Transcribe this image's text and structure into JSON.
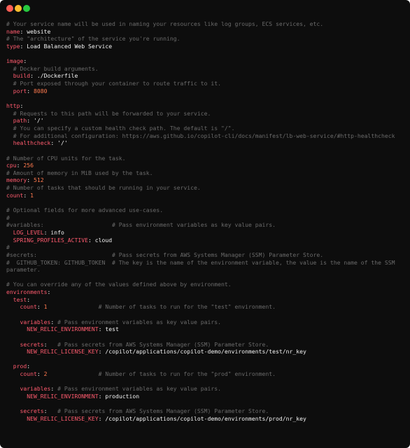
{
  "window": {
    "controls": [
      {
        "name": "close-button",
        "color": "#ff5f56"
      },
      {
        "name": "minimize-button",
        "color": "#ffbd2e"
      },
      {
        "name": "zoom-button",
        "color": "#27c93f"
      }
    ]
  },
  "lines": [
    [
      {
        "t": "c",
        "s": "# Your service name will be used in naming your resources like log groups, ECS services, etc."
      }
    ],
    [
      {
        "t": "k",
        "s": "name"
      },
      {
        "t": "v",
        "s": ": website"
      }
    ],
    [
      {
        "t": "c",
        "s": "# The \"architecture\" of the service you're running."
      }
    ],
    [
      {
        "t": "k",
        "s": "type"
      },
      {
        "t": "v",
        "s": ": Load Balanced Web Service"
      }
    ],
    [],
    [
      {
        "t": "k",
        "s": "image"
      },
      {
        "t": "v",
        "s": ":"
      }
    ],
    [
      {
        "t": "c",
        "s": "  # Docker build arguments."
      }
    ],
    [
      {
        "t": "v",
        "s": "  "
      },
      {
        "t": "k",
        "s": "build"
      },
      {
        "t": "v",
        "s": ": ./Dockerfile"
      }
    ],
    [
      {
        "t": "c",
        "s": "  # Port exposed through your container to route traffic to it."
      }
    ],
    [
      {
        "t": "v",
        "s": "  "
      },
      {
        "t": "k",
        "s": "port"
      },
      {
        "t": "v",
        "s": ": "
      },
      {
        "t": "n",
        "s": "8080"
      }
    ],
    [],
    [
      {
        "t": "k",
        "s": "http"
      },
      {
        "t": "v",
        "s": ":"
      }
    ],
    [
      {
        "t": "c",
        "s": "  # Requests to this path will be forwarded to your service."
      }
    ],
    [
      {
        "t": "v",
        "s": "  "
      },
      {
        "t": "k",
        "s": "path"
      },
      {
        "t": "v",
        "s": ": '/'"
      }
    ],
    [
      {
        "t": "c",
        "s": "  # You can specify a custom health check path. The default is \"/\"."
      }
    ],
    [
      {
        "t": "c",
        "s": "  # For additional configuration: https://aws.github.io/copilot-cli/docs/manifest/lb-web-service/#http-healthcheck"
      }
    ],
    [
      {
        "t": "v",
        "s": "  "
      },
      {
        "t": "k",
        "s": "healthcheck"
      },
      {
        "t": "v",
        "s": ": '/'"
      }
    ],
    [],
    [
      {
        "t": "c",
        "s": "# Number of CPU units for the task."
      }
    ],
    [
      {
        "t": "k",
        "s": "cpu"
      },
      {
        "t": "v",
        "s": ": "
      },
      {
        "t": "n",
        "s": "256"
      }
    ],
    [
      {
        "t": "c",
        "s": "# Amount of memory in MiB used by the task."
      }
    ],
    [
      {
        "t": "k",
        "s": "memory"
      },
      {
        "t": "v",
        "s": ": "
      },
      {
        "t": "n",
        "s": "512"
      }
    ],
    [
      {
        "t": "c",
        "s": "# Number of tasks that should be running in your service."
      }
    ],
    [
      {
        "t": "k",
        "s": "count"
      },
      {
        "t": "v",
        "s": ": "
      },
      {
        "t": "n",
        "s": "1"
      }
    ],
    [],
    [
      {
        "t": "c",
        "s": "# Optional fields for more advanced use-cases."
      }
    ],
    [
      {
        "t": "c",
        "s": "#"
      }
    ],
    [
      {
        "t": "c",
        "s": "#variables:                    # Pass environment variables as key value pairs."
      }
    ],
    [
      {
        "t": "v",
        "s": "  "
      },
      {
        "t": "k",
        "s": "LOG_LEVEL"
      },
      {
        "t": "v",
        "s": ": info"
      }
    ],
    [
      {
        "t": "v",
        "s": "  "
      },
      {
        "t": "k",
        "s": "SPRING_PROFILES_ACTIVE"
      },
      {
        "t": "v",
        "s": ": cloud"
      }
    ],
    [
      {
        "t": "c",
        "s": "#"
      }
    ],
    [
      {
        "t": "c",
        "s": "#secrets:                      # Pass secrets from AWS Systems Manager (SSM) Parameter Store."
      }
    ],
    [
      {
        "t": "c",
        "s": "#  GITHUB_TOKEN: GITHUB_TOKEN  # The key is the name of the environment variable, the value is the name of the SSM"
      }
    ],
    [
      {
        "t": "c",
        "s": "parameter."
      }
    ],
    [],
    [
      {
        "t": "c",
        "s": "# You can override any of the values defined above by environment."
      }
    ],
    [
      {
        "t": "k",
        "s": "environments"
      },
      {
        "t": "v",
        "s": ":"
      }
    ],
    [
      {
        "t": "v",
        "s": "  "
      },
      {
        "t": "k",
        "s": "test"
      },
      {
        "t": "v",
        "s": ":"
      }
    ],
    [
      {
        "t": "v",
        "s": "    "
      },
      {
        "t": "k",
        "s": "count"
      },
      {
        "t": "v",
        "s": ": "
      },
      {
        "t": "n",
        "s": "1"
      },
      {
        "t": "c",
        "s": "               # Number of tasks to run for the \"test\" environment."
      }
    ],
    [],
    [
      {
        "t": "v",
        "s": "    "
      },
      {
        "t": "k",
        "s": "variables"
      },
      {
        "t": "v",
        "s": ": "
      },
      {
        "t": "c",
        "s": "# Pass environment variables as key value pairs."
      }
    ],
    [
      {
        "t": "v",
        "s": "      "
      },
      {
        "t": "k",
        "s": "NEW_RELIC_ENVIRONMENT"
      },
      {
        "t": "v",
        "s": ": test"
      }
    ],
    [],
    [
      {
        "t": "v",
        "s": "    "
      },
      {
        "t": "k",
        "s": "secrets"
      },
      {
        "t": "v",
        "s": ":   "
      },
      {
        "t": "c",
        "s": "# Pass secrets from AWS Systems Manager (SSM) Parameter Store."
      }
    ],
    [
      {
        "t": "v",
        "s": "      "
      },
      {
        "t": "k",
        "s": "NEW_RELIC_LICENSE_KEY"
      },
      {
        "t": "v",
        "s": ": /copilot/applications/copilot-demo/environments/test/nr_key"
      }
    ],
    [],
    [
      {
        "t": "v",
        "s": "  "
      },
      {
        "t": "k",
        "s": "prod"
      },
      {
        "t": "v",
        "s": ":"
      }
    ],
    [
      {
        "t": "v",
        "s": "    "
      },
      {
        "t": "k",
        "s": "count"
      },
      {
        "t": "v",
        "s": ": "
      },
      {
        "t": "n",
        "s": "2"
      },
      {
        "t": "c",
        "s": "               # Number of tasks to run for the \"prod\" environment."
      }
    ],
    [],
    [
      {
        "t": "v",
        "s": "    "
      },
      {
        "t": "k",
        "s": "variables"
      },
      {
        "t": "v",
        "s": ": "
      },
      {
        "t": "c",
        "s": "# Pass environment variables as key value pairs."
      }
    ],
    [
      {
        "t": "v",
        "s": "      "
      },
      {
        "t": "k",
        "s": "NEW_RELIC_ENVIRONMENT"
      },
      {
        "t": "v",
        "s": ": production"
      }
    ],
    [],
    [
      {
        "t": "v",
        "s": "    "
      },
      {
        "t": "k",
        "s": "secrets"
      },
      {
        "t": "v",
        "s": ":   "
      },
      {
        "t": "c",
        "s": "# Pass secrets from AWS Systems Manager (SSM) Parameter Store."
      }
    ],
    [
      {
        "t": "v",
        "s": "      "
      },
      {
        "t": "k",
        "s": "NEW_RELIC_LICENSE_KEY"
      },
      {
        "t": "v",
        "s": ": /copilot/applications/copilot-demo/environments/prod/nr_key"
      }
    ]
  ]
}
